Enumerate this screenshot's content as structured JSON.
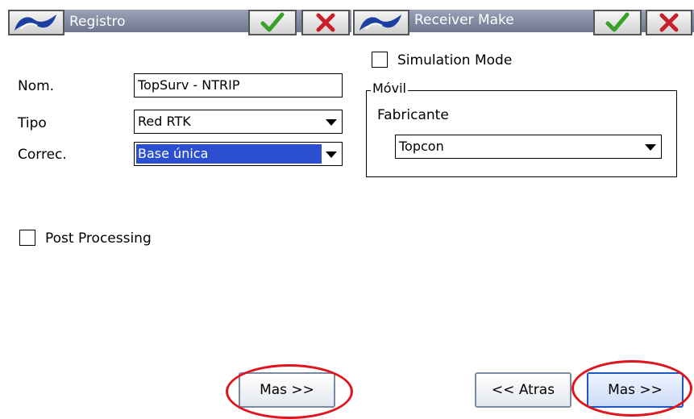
{
  "left_panel": {
    "title": "Registro",
    "fields": {
      "nom_label": "Nom.",
      "nom_value": "TopSurv - NTRIP",
      "tipo_label": "Tipo",
      "tipo_value": "Red RTK",
      "correc_label": "Correc.",
      "correc_value": "Base única"
    },
    "post_processing_label": "Post Processing",
    "next_button": "Mas >>"
  },
  "right_panel": {
    "title": "Receiver Make",
    "simulation_mode_label": "Simulation Mode",
    "group_label": "Móvil",
    "fabricante_label": "Fabricante",
    "fabricante_value": "Topcon",
    "back_button": "<< Atras",
    "next_button": "Mas >>"
  },
  "icons": {
    "logo": "topcon-logo-icon",
    "ok": "check-icon",
    "cancel": "close-x-icon"
  },
  "colors": {
    "titlebar": "#7a839a",
    "selection": "#2b4fd0",
    "ok_green": "#3ba02a",
    "cancel_red": "#c8202a",
    "annotation_red": "#e0141c"
  }
}
